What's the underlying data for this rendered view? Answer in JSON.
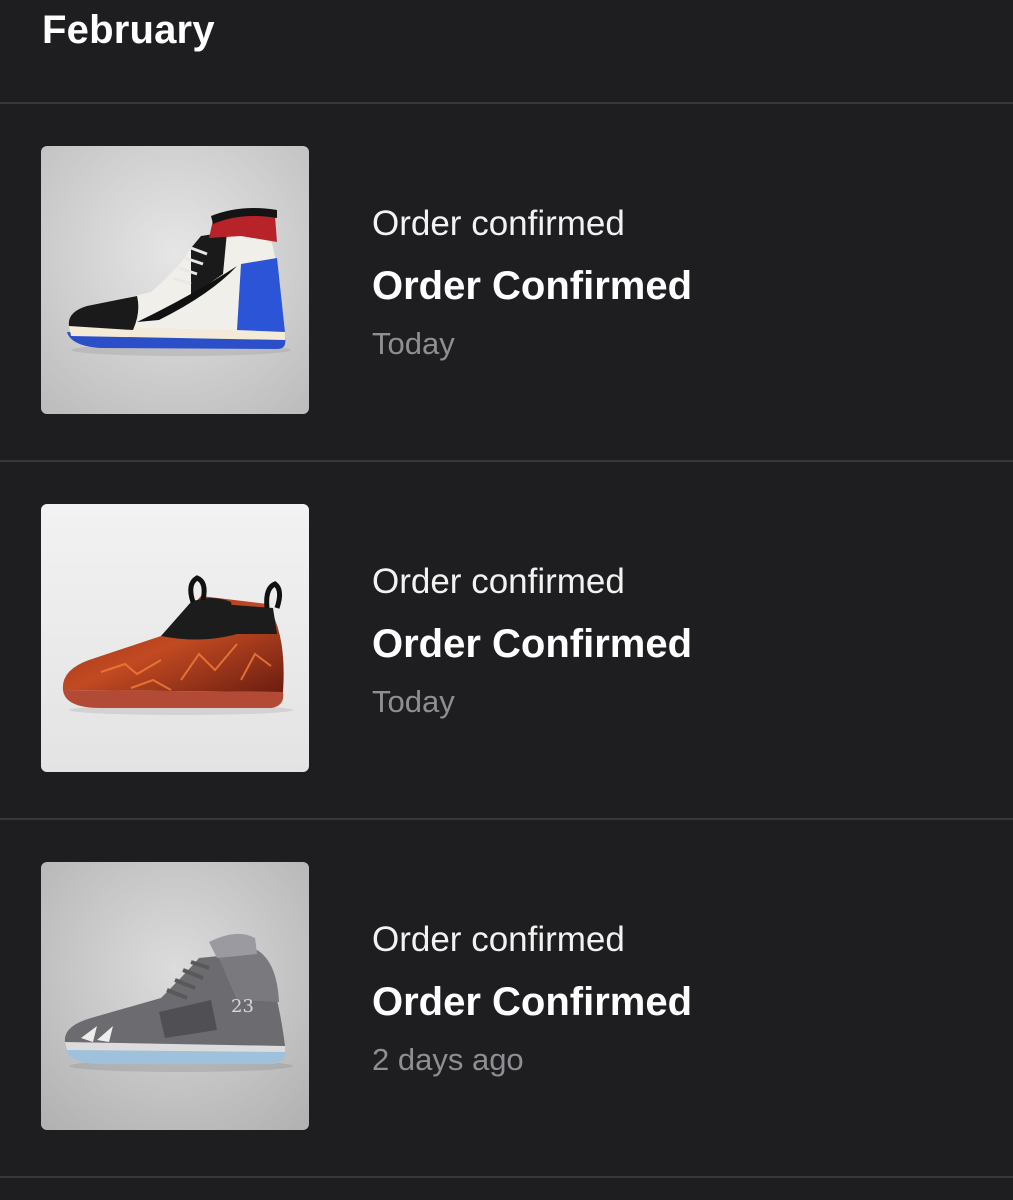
{
  "section": {
    "title": "February"
  },
  "notifications": [
    {
      "eyebrow": "Order confirmed",
      "title": "Order Confirmed",
      "time": "Today",
      "image": "sneaker-high-top-red-white-blue"
    },
    {
      "eyebrow": "Order confirmed",
      "title": "Order Confirmed",
      "time": "Today",
      "image": "sneaker-foamposite-red-lava"
    },
    {
      "eyebrow": "Order confirmed",
      "title": "Order Confirmed",
      "time": "2 days ago",
      "image": "sneaker-grey-suede-23"
    }
  ],
  "colors": {
    "background": "#1e1e20",
    "divider": "#38383b",
    "primary_text": "#ffffff",
    "secondary_text": "#8e8e93"
  }
}
